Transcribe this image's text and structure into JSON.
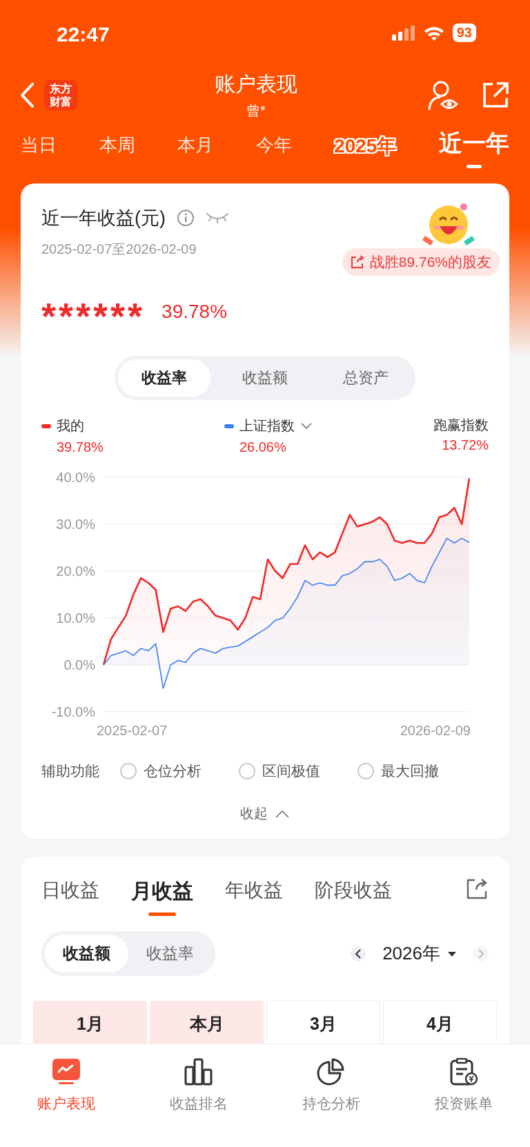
{
  "status_bar": {
    "time": "22:47",
    "battery": "93"
  },
  "header": {
    "logo": "东方财富",
    "title": "账户表现",
    "subtitle": "曾*"
  },
  "period_tabs": [
    {
      "label": "当日",
      "kind": "plain",
      "selected": false
    },
    {
      "label": "本周",
      "kind": "plain",
      "selected": false
    },
    {
      "label": "本月",
      "kind": "plain",
      "selected": false
    },
    {
      "label": "今年",
      "kind": "plain",
      "selected": false
    },
    {
      "label": "2025年",
      "kind": "promo",
      "selected": false
    },
    {
      "label": "近一年",
      "kind": "plain",
      "selected": true
    }
  ],
  "summary_card": {
    "title": "近一年收益(元)",
    "date_range": "2025-02-07至2026-02-09",
    "rank_badge": "战胜89.76%的股友",
    "amount": "******",
    "rate": "39.78%",
    "segments": [
      {
        "label": "收益率",
        "selected": true
      },
      {
        "label": "收益额",
        "selected": false
      },
      {
        "label": "总资产",
        "selected": false
      }
    ],
    "legend_values": [
      {
        "value": "39.78%"
      },
      {
        "value": "26.06%",
        "dropdown": true
      }
    ],
    "outperform": {
      "label": "跑赢指数",
      "value": "13.72%"
    },
    "axis_dates": [
      "2025-02-07",
      "2026-02-09"
    ],
    "chart_data": {
      "type": "area",
      "grid": true,
      "ylim": [
        -10,
        40
      ],
      "yticks": [
        {
          "value": 40,
          "label": "40.0%"
        },
        {
          "value": 30,
          "label": "30.0%"
        },
        {
          "value": 20,
          "label": "20.0%"
        },
        {
          "value": 10,
          "label": "10.0%"
        },
        {
          "value": 0,
          "label": "0.0%"
        },
        {
          "value": -10,
          "label": "-10.0%"
        }
      ],
      "series": [
        {
          "name": "我的",
          "color": "#f02828",
          "values": [
            0,
            5.5,
            8,
            10.5,
            15,
            18.5,
            17.5,
            16,
            7,
            12,
            12.5,
            11.5,
            13.5,
            14,
            12.5,
            10.5,
            10,
            9.5,
            7.5,
            10,
            14.5,
            14,
            22.5,
            20,
            18.5,
            21.5,
            21.5,
            25.5,
            22.5,
            24,
            23,
            24,
            28,
            32,
            29.5,
            30,
            30.5,
            31.5,
            30,
            26.5,
            26,
            26.5,
            26,
            26,
            28,
            31.5,
            32,
            33.5,
            30,
            39.8
          ]
        },
        {
          "name": "上证指数",
          "color": "#3a7ff0",
          "values": [
            0,
            2,
            2.5,
            3,
            2,
            3.5,
            3,
            4.5,
            -5,
            0,
            1,
            0.5,
            2.5,
            3.5,
            3,
            2.5,
            3.5,
            3.8,
            4,
            5,
            6,
            7,
            8,
            9.5,
            10,
            12,
            14.5,
            18,
            17,
            17.5,
            17,
            17,
            19,
            19.5,
            20.5,
            22,
            22,
            22.5,
            21,
            18,
            18.5,
            19.5,
            18,
            17.5,
            21,
            24,
            27,
            26,
            27,
            26.1
          ]
        }
      ]
    },
    "assist_label": "辅助功能",
    "assist_options": [
      {
        "label": "仓位分析",
        "checked": false
      },
      {
        "label": "区间极值",
        "checked": false
      },
      {
        "label": "最大回撤",
        "checked": false
      }
    ],
    "collapse": "收起"
  },
  "profit_card": {
    "tabs": [
      {
        "label": "日收益",
        "selected": false
      },
      {
        "label": "月收益",
        "selected": true
      },
      {
        "label": "年收益",
        "selected": false
      },
      {
        "label": "阶段收益",
        "selected": false
      }
    ],
    "segments": [
      {
        "label": "收益额",
        "selected": true
      },
      {
        "label": "收益率",
        "selected": false
      }
    ],
    "year": "2026年",
    "next_disabled": true,
    "months": [
      {
        "label": "1月",
        "color": "#fde7e7"
      },
      {
        "label": "本月",
        "color": "#fde7e7"
      },
      {
        "label": "3月",
        "color": "#ffffff"
      },
      {
        "label": "4月",
        "color": "#ffffff"
      }
    ]
  },
  "bottom_nav": [
    {
      "label": "账户表现",
      "selected": true
    },
    {
      "label": "收益排名",
      "selected": false
    },
    {
      "label": "持仓分析",
      "selected": false
    },
    {
      "label": "投资账单",
      "selected": false
    }
  ]
}
